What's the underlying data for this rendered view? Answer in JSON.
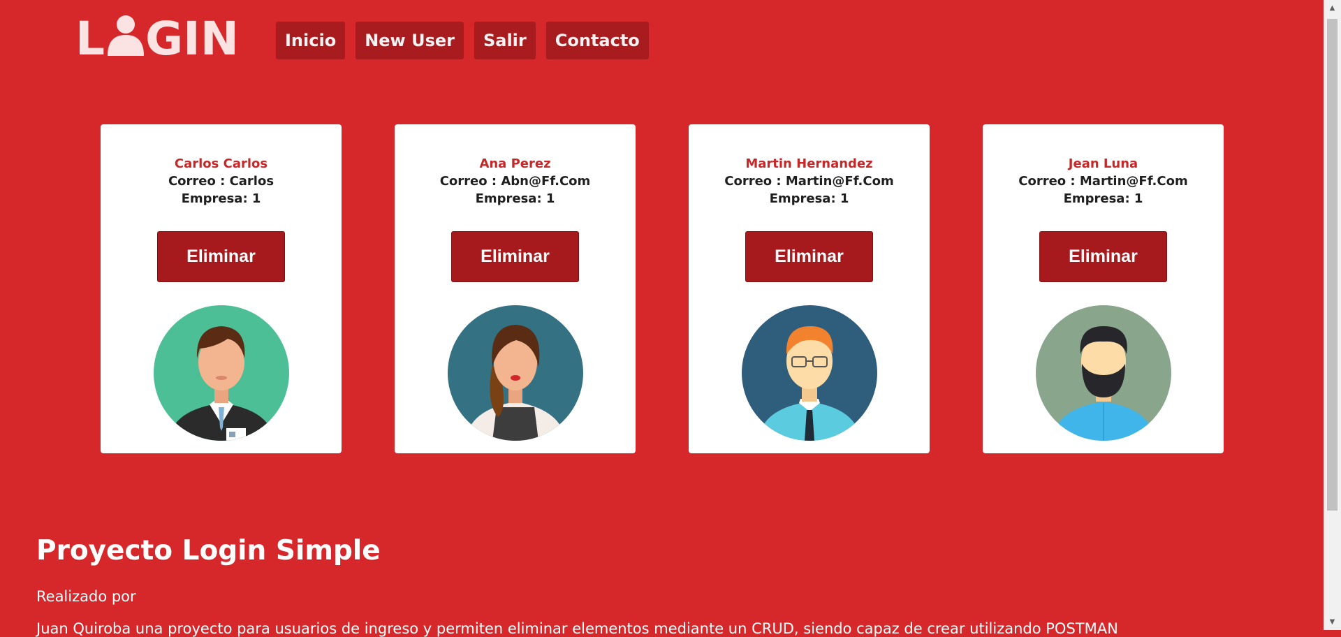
{
  "brand": {
    "logo_text_prefix": "L",
    "logo_text_suffix": "GIN",
    "logo_color": "#fbe3e3"
  },
  "nav": {
    "items": [
      {
        "label": "Inicio"
      },
      {
        "label": "New User"
      },
      {
        "label": "Salir"
      },
      {
        "label": "Contacto"
      }
    ]
  },
  "users": [
    {
      "name": "Carlos Carlos",
      "correo": "Correo : Carlos",
      "empresa": "Empresa: 1",
      "button": "Eliminar",
      "avatar": "man-suit-avatar-icon"
    },
    {
      "name": "Ana Perez",
      "correo": "Correo : Abn@Ff.Com",
      "empresa": "Empresa: 1",
      "button": "Eliminar",
      "avatar": "woman-avatar-icon"
    },
    {
      "name": "Martin Hernandez",
      "correo": "Correo : Martin@Ff.Com",
      "empresa": "Empresa: 1",
      "button": "Eliminar",
      "avatar": "man-glasses-avatar-icon"
    },
    {
      "name": "Jean Luna",
      "correo": "Correo : Martin@Ff.Com",
      "empresa": "Empresa: 1",
      "button": "Eliminar",
      "avatar": "bearded-man-avatar-icon"
    }
  ],
  "footer": {
    "title": "Proyecto Login Simple",
    "realizado": "Realizado por",
    "description": "Juan Quiroba una proyecto para usuarios de ingreso y permiten eliminar elementos mediante un CRUD, siendo capaz de crear utilizando POSTMAN"
  },
  "colors": {
    "background": "#d6282a",
    "nav_button": "#a81b1e",
    "card_name": "#c62828",
    "delete_button": "#a61a1d"
  }
}
